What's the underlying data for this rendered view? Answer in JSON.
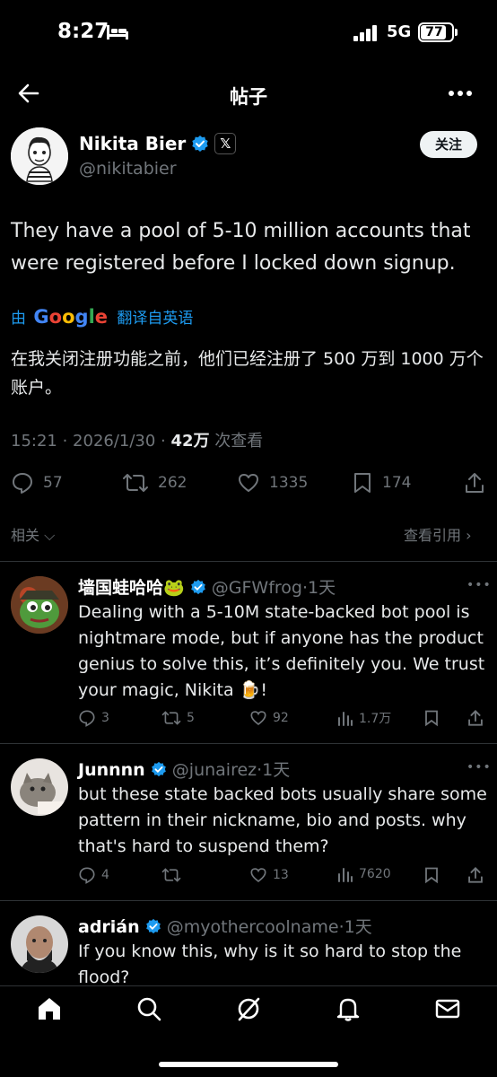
{
  "status_bar": {
    "time": "8:27",
    "network": "5G",
    "battery": "77"
  },
  "header": {
    "title": "帖子"
  },
  "author": {
    "name": "Nikita Bier",
    "handle": "@nikitabier",
    "follow_label": "关注"
  },
  "post": {
    "text": "They have a pool of 5-10 million accounts that were registered before I locked down signup.",
    "translate_prefix": "由",
    "translate_brand": "Google",
    "translate_suffix": "翻译自英语",
    "translated_text": "在我关闭注册功能之前，他们已经注册了 500 万到 1000 万个账户。",
    "datetime": "15:21 · 2026/1/30 · ",
    "views_count": "42万",
    "views_label": " 次查看"
  },
  "actions": {
    "replies": "57",
    "reposts": "262",
    "likes": "1335",
    "bookmarks": "174"
  },
  "links": {
    "related": "相关",
    "view_quotes": "查看引用"
  },
  "replies": [
    {
      "name": "墙国蛙哈哈🐸",
      "handle": "@GFWfrog",
      "time": "·1天",
      "text": "Dealing with a 5-10M state-backed bot pool is nightmare mode, but if anyone has the product genius to solve this, it’s definitely you. We trust your magic, Nikita 🍺!",
      "replies": "3",
      "reposts": "5",
      "likes": "92",
      "views": "1.7万"
    },
    {
      "name": "Junnnn",
      "handle": "@junairez",
      "time": "·1天",
      "text": "but these state backed bots usually share some pattern in their nickname, bio and posts. why that's hard to suspend them?",
      "replies": "4",
      "reposts": "",
      "likes": "13",
      "views": "7620"
    },
    {
      "name": "adrián",
      "handle": "@myothercoolname",
      "time": "·1天",
      "text": "If you know this, why is it so hard to stop the flood?"
    }
  ],
  "colors": {
    "accent": "#1d9bf0",
    "muted": "#71767b",
    "background": "#000000"
  }
}
